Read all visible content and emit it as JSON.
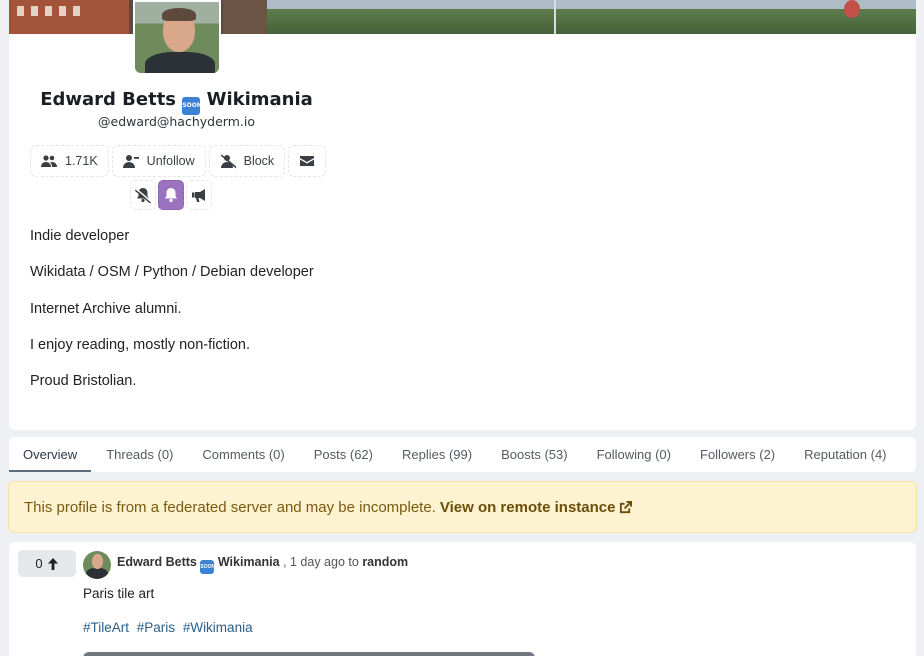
{
  "profile": {
    "display_name_prefix": "Edward Betts",
    "display_name_emoji": "SOON",
    "display_name_suffix": "Wikimania",
    "handle": "@edward@hachyderm.io",
    "actions": {
      "followers_count": "1.71K",
      "unfollow_label": "Unfollow",
      "block_label": "Block"
    },
    "bio": [
      "Indie developer",
      "Wikidata / OSM / Python / Debian developer",
      "Internet Archive alumni.",
      "I enjoy reading, mostly non-fiction.",
      "Proud Bristolian."
    ]
  },
  "tabs": [
    {
      "label": "Overview",
      "active": true
    },
    {
      "label": "Threads (0)"
    },
    {
      "label": "Comments (0)"
    },
    {
      "label": "Posts (62)"
    },
    {
      "label": "Replies (99)"
    },
    {
      "label": "Boosts (53)"
    },
    {
      "label": "Following (0)"
    },
    {
      "label": "Followers (2)"
    },
    {
      "label": "Reputation (4)"
    }
  ],
  "notice": {
    "text": "This profile is from a federated server and may be incomplete.",
    "link_label": "View on remote instance"
  },
  "post": {
    "score": "0",
    "author_prefix": "Edward Betts",
    "author_emoji": "SOON",
    "author_suffix": "Wikimania",
    "time_text": ", 1 day ago to",
    "community": "random",
    "title": "Paris tile art",
    "tags": [
      "#TileArt",
      "#Paris",
      "#Wikimania"
    ]
  },
  "colors": {
    "notification_active": "#9a72c0",
    "notice_bg": "#fdf3d0",
    "tag_link": "#2c5e86"
  }
}
